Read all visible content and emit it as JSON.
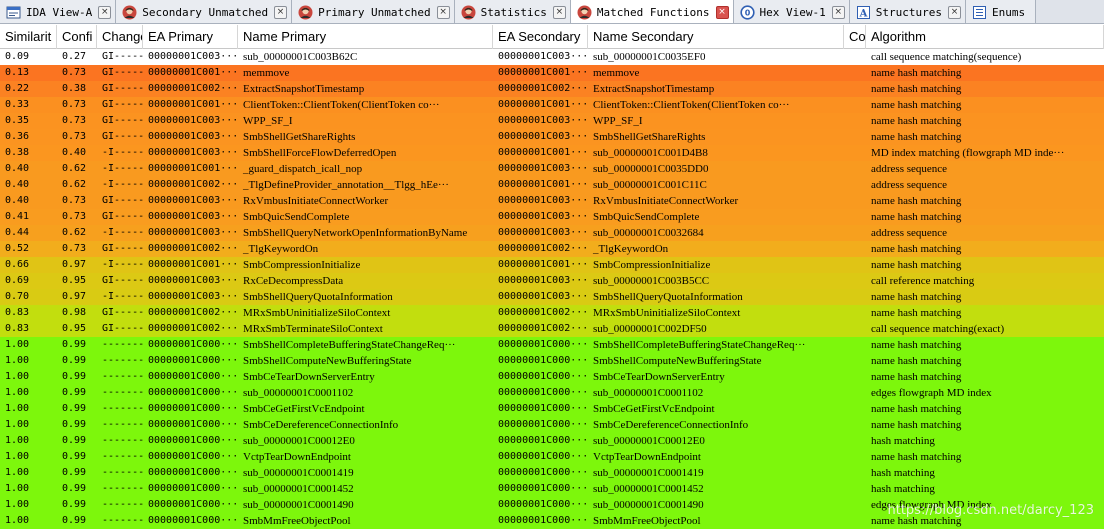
{
  "tabs": [
    {
      "label": "IDA View-A",
      "icon": "ida-view-icon",
      "active": false
    },
    {
      "label": "Secondary Unmatched",
      "icon": "bindiff-avatar-icon",
      "active": false
    },
    {
      "label": "Primary Unmatched",
      "icon": "bindiff-avatar-icon",
      "active": false
    },
    {
      "label": "Statistics",
      "icon": "bindiff-avatar-icon",
      "active": false
    },
    {
      "label": "Matched Functions",
      "icon": "bindiff-avatar-icon",
      "active": true
    },
    {
      "label": "Hex View-1",
      "icon": "hex-view-icon",
      "active": false
    },
    {
      "label": "Structures",
      "icon": "structures-icon",
      "active": false
    },
    {
      "label": "Enums",
      "icon": "enums-icon",
      "active": false
    }
  ],
  "close_glyph": "×",
  "columns": [
    "Similarit",
    "Confi",
    "Change",
    "EA Primary",
    "Name Primary",
    "EA Secondary",
    "Name Secondary",
    "Co",
    "Algorithm"
  ],
  "rows": [
    {
      "sim": "0.09",
      "conf": "0.27",
      "chg": "GI-----",
      "eap": "00000001C003···",
      "np": "sub_00000001C003B62C",
      "eas": "00000001C003···",
      "ns": "sub_00000001C0035EF0",
      "co": "",
      "alg": "call sequence matching(sequence)",
      "color": "#ffffff"
    },
    {
      "sim": "0.13",
      "conf": "0.73",
      "chg": "GI-----",
      "eap": "00000001C001···",
      "np": "memmove",
      "eas": "00000001C001···",
      "ns": "memmove",
      "co": "",
      "alg": "name hash matching",
      "color": "#fb7421"
    },
    {
      "sim": "0.22",
      "conf": "0.38",
      "chg": "GI-----",
      "eap": "00000001C002···",
      "np": "ExtractSnapshotTimestamp",
      "eas": "00000001C002···",
      "ns": "ExtractSnapshotTimestamp",
      "co": "",
      "alg": "name hash matching",
      "color": "#fb8222"
    },
    {
      "sim": "0.33",
      "conf": "0.73",
      "chg": "GI-----",
      "eap": "00000001C001···",
      "np": "ClientToken::ClientToken(ClientToken co···",
      "eas": "00000001C001···",
      "ns": "ClientToken::ClientToken(ClientToken co···",
      "co": "",
      "alg": "name hash matching",
      "color": "#fb9020"
    },
    {
      "sim": "0.35",
      "conf": "0.73",
      "chg": "GI-----",
      "eap": "00000001C003···",
      "np": "WPP_SF_I",
      "eas": "00000001C003···",
      "ns": "WPP_SF_I",
      "co": "",
      "alg": "name hash matching",
      "color": "#fb9320"
    },
    {
      "sim": "0.36",
      "conf": "0.73",
      "chg": "GI-----",
      "eap": "00000001C003···",
      "np": "SmbShellGetShareRights",
      "eas": "00000001C003···",
      "ns": "SmbShellGetShareRights",
      "co": "",
      "alg": "name hash matching",
      "color": "#fb9420"
    },
    {
      "sim": "0.38",
      "conf": "0.40",
      "chg": "-I-----",
      "eap": "00000001C003···",
      "np": "SmbShellForceFlowDeferredOpen",
      "eas": "00000001C001···",
      "ns": "sub_00000001C001D4B8",
      "co": "",
      "alg": "MD index matching (flowgraph MD inde···",
      "color": "#fb961f"
    },
    {
      "sim": "0.40",
      "conf": "0.62",
      "chg": "-I-----",
      "eap": "00000001C001···",
      "np": "_guard_dispatch_icall_nop",
      "eas": "00000001C003···",
      "ns": "sub_00000001C0035DD0",
      "co": "",
      "alg": "address sequence",
      "color": "#f99a1f"
    },
    {
      "sim": "0.40",
      "conf": "0.62",
      "chg": "-I-----",
      "eap": "00000001C002···",
      "np": "_TlgDefineProvider_annotation__Tlgg_hEe···",
      "eas": "00000001C001···",
      "ns": "sub_00000001C001C11C",
      "co": "",
      "alg": "address sequence",
      "color": "#f99a1f"
    },
    {
      "sim": "0.40",
      "conf": "0.73",
      "chg": "GI-----",
      "eap": "00000001C003···",
      "np": "RxVmbusInitiateConnectWorker",
      "eas": "00000001C003···",
      "ns": "RxVmbusInitiateConnectWorker",
      "co": "",
      "alg": "name hash matching",
      "color": "#f99a1f"
    },
    {
      "sim": "0.41",
      "conf": "0.73",
      "chg": "GI-----",
      "eap": "00000001C003···",
      "np": "SmbQuicSendComplete",
      "eas": "00000001C003···",
      "ns": "SmbQuicSendComplete",
      "co": "",
      "alg": "name hash matching",
      "color": "#f99c1f"
    },
    {
      "sim": "0.44",
      "conf": "0.62",
      "chg": "-I-----",
      "eap": "00000001C003···",
      "np": "SmbShellQueryNetworkOpenInformationByName",
      "eas": "00000001C003···",
      "ns": "sub_00000001C0032684",
      "co": "",
      "alg": "address sequence",
      "color": "#f7a01e"
    },
    {
      "sim": "0.52",
      "conf": "0.73",
      "chg": "GI-----",
      "eap": "00000001C002···",
      "np": "_TlgKeywordOn",
      "eas": "00000001C002···",
      "ns": "_TlgKeywordOn",
      "co": "",
      "alg": "name hash matching",
      "color": "#f2ad1c"
    },
    {
      "sim": "0.66",
      "conf": "0.97",
      "chg": "-I-----",
      "eap": "00000001C001···",
      "np": "SmbCompressionInitialize",
      "eas": "00000001C001···",
      "ns": "SmbCompressionInitialize",
      "co": "",
      "alg": "name hash matching",
      "color": "#e0c415"
    },
    {
      "sim": "0.69",
      "conf": "0.95",
      "chg": "GI-----",
      "eap": "00000001C003···",
      "np": "RxCeDecompressData",
      "eas": "00000001C003···",
      "ns": "sub_00000001C003B5CC",
      "co": "",
      "alg": "call reference matching",
      "color": "#dcc914"
    },
    {
      "sim": "0.70",
      "conf": "0.97",
      "chg": "-I-----",
      "eap": "00000001C003···",
      "np": "SmbShellQueryQuotaInformation",
      "eas": "00000001C003···",
      "ns": "SmbShellQueryQuotaInformation",
      "co": "",
      "alg": "name hash matching",
      "color": "#d9cb13"
    },
    {
      "sim": "0.83",
      "conf": "0.98",
      "chg": "GI-----",
      "eap": "00000001C002···",
      "np": "MRxSmbUninitializeSiloContext",
      "eas": "00000001C002···",
      "ns": "MRxSmbUninitializeSiloContext",
      "co": "",
      "alg": "name hash matching",
      "color": "#c2de0e"
    },
    {
      "sim": "0.83",
      "conf": "0.95",
      "chg": "GI-----",
      "eap": "00000001C002···",
      "np": "MRxSmbTerminateSiloContext",
      "eas": "00000001C002···",
      "ns": "sub_00000001C002DF50",
      "co": "",
      "alg": "call sequence matching(exact)",
      "color": "#c2de0e"
    },
    {
      "sim": "1.00",
      "conf": "0.99",
      "chg": "-------",
      "eap": "00000001C000···",
      "np": "SmbShellCompleteBufferingStateChangeReq···",
      "eas": "00000001C000···",
      "ns": "SmbShellCompleteBufferingStateChangeReq···",
      "co": "",
      "alg": "name hash matching",
      "color": "#7df70c"
    },
    {
      "sim": "1.00",
      "conf": "0.99",
      "chg": "-------",
      "eap": "00000001C000···",
      "np": "SmbShellComputeNewBufferingState",
      "eas": "00000001C000···",
      "ns": "SmbShellComputeNewBufferingState",
      "co": "",
      "alg": "name hash matching",
      "color": "#7df70c"
    },
    {
      "sim": "1.00",
      "conf": "0.99",
      "chg": "-------",
      "eap": "00000001C000···",
      "np": "SmbCeTearDownServerEntry",
      "eas": "00000001C000···",
      "ns": "SmbCeTearDownServerEntry",
      "co": "",
      "alg": "name hash matching",
      "color": "#7df70c"
    },
    {
      "sim": "1.00",
      "conf": "0.99",
      "chg": "-------",
      "eap": "00000001C000···",
      "np": "sub_00000001C0001102",
      "eas": "00000001C000···",
      "ns": "sub_00000001C0001102",
      "co": "",
      "alg": "edges flowgraph MD index",
      "color": "#7df70c"
    },
    {
      "sim": "1.00",
      "conf": "0.99",
      "chg": "-------",
      "eap": "00000001C000···",
      "np": "SmbCeGetFirstVcEndpoint",
      "eas": "00000001C000···",
      "ns": "SmbCeGetFirstVcEndpoint",
      "co": "",
      "alg": "name hash matching",
      "color": "#7df70c"
    },
    {
      "sim": "1.00",
      "conf": "0.99",
      "chg": "-------",
      "eap": "00000001C000···",
      "np": "SmbCeDereferenceConnectionInfo",
      "eas": "00000001C000···",
      "ns": "SmbCeDereferenceConnectionInfo",
      "co": "",
      "alg": "name hash matching",
      "color": "#7df70c"
    },
    {
      "sim": "1.00",
      "conf": "0.99",
      "chg": "-------",
      "eap": "00000001C000···",
      "np": "sub_00000001C00012E0",
      "eas": "00000001C000···",
      "ns": "sub_00000001C00012E0",
      "co": "",
      "alg": "hash matching",
      "color": "#7df70c"
    },
    {
      "sim": "1.00",
      "conf": "0.99",
      "chg": "-------",
      "eap": "00000001C000···",
      "np": "VctpTearDownEndpoint",
      "eas": "00000001C000···",
      "ns": "VctpTearDownEndpoint",
      "co": "",
      "alg": "name hash matching",
      "color": "#7df70c"
    },
    {
      "sim": "1.00",
      "conf": "0.99",
      "chg": "-------",
      "eap": "00000001C000···",
      "np": "sub_00000001C0001419",
      "eas": "00000001C000···",
      "ns": "sub_00000001C0001419",
      "co": "",
      "alg": "hash matching",
      "color": "#7df70c"
    },
    {
      "sim": "1.00",
      "conf": "0.99",
      "chg": "-------",
      "eap": "00000001C000···",
      "np": "sub_00000001C0001452",
      "eas": "00000001C000···",
      "ns": "sub_00000001C0001452",
      "co": "",
      "alg": "hash matching",
      "color": "#7df70c"
    },
    {
      "sim": "1.00",
      "conf": "0.99",
      "chg": "-------",
      "eap": "00000001C000···",
      "np": "sub_00000001C0001490",
      "eas": "00000001C000···",
      "ns": "sub_00000001C0001490",
      "co": "",
      "alg": "edges flowgraph MD index",
      "color": "#7df70c"
    },
    {
      "sim": "1.00",
      "conf": "0.99",
      "chg": "-------",
      "eap": "00000001C000···",
      "np": "SmbMmFreeObjectPool",
      "eas": "00000001C000···",
      "ns": "SmbMmFreeObjectPool",
      "co": "",
      "alg": "name hash matching",
      "color": "#7df70c"
    }
  ],
  "watermark": "https://blog.csdn.net/darcy_123"
}
